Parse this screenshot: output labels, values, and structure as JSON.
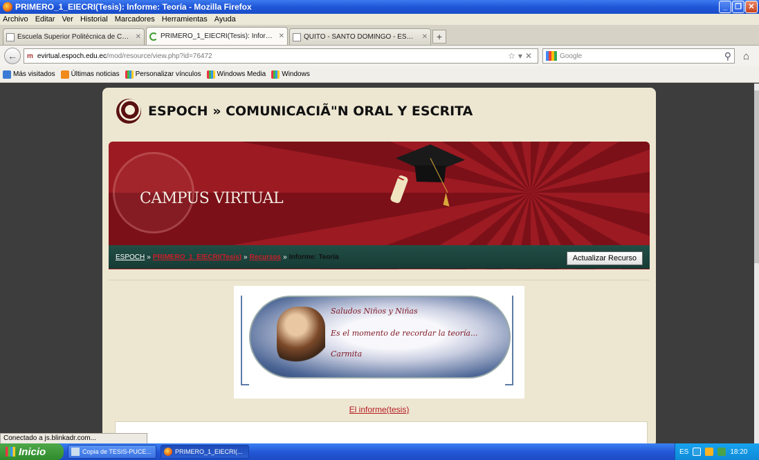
{
  "window": {
    "title": "PRIMERO_1_EIECRI(Tesis): Informe: Teoría - Mozilla Firefox"
  },
  "menu": [
    "Archivo",
    "Editar",
    "Ver",
    "Historial",
    "Marcadores",
    "Herramientas",
    "Ayuda"
  ],
  "tabs": [
    {
      "label": "Escuela Superior Politécnica de Chimborazo"
    },
    {
      "label": "PRIMERO_1_EIECRI(Tesis): Informe: Te..."
    },
    {
      "label": "QUITO - SANTO DOMINGO - ESMERALDA..."
    }
  ],
  "nav": {
    "url_host": "evirtual.espoch.edu.ec",
    "url_path": "/mod/resource/view.php?id=76472",
    "search_placeholder": "Google"
  },
  "bookmarks": [
    "Más visitados",
    "Últimas noticias",
    "Personalizar vínculos",
    "Windows Media",
    "Windows"
  ],
  "site": {
    "title": "ESPOCH » COMUNICACIÃ\"N ORAL Y ESCRITA",
    "banner_text": "CAMPUS VIRTUAL",
    "breadcrumb": {
      "home": "ESPOCH",
      "course": "PRIMERO_1_EIECRI(Tesis)",
      "resources": "Recursos",
      "current": "Informe: Teoría",
      "sep": "»"
    },
    "update_button": "Actualizar Recurso",
    "image_lines": [
      "Saludos Niños y Niñas",
      "Es el momento de recordar la teoría...",
      "Carmita"
    ],
    "doc_link": "El informe(tesis)"
  },
  "status": "Conectado a js.blinkadr.com...",
  "taskbar": {
    "start": "Inicio",
    "items": [
      "Copia de TESIS-PUCE...",
      "PRIMERO_1_EIECRI(..."
    ],
    "lang": "ES",
    "clock": "18:20"
  }
}
